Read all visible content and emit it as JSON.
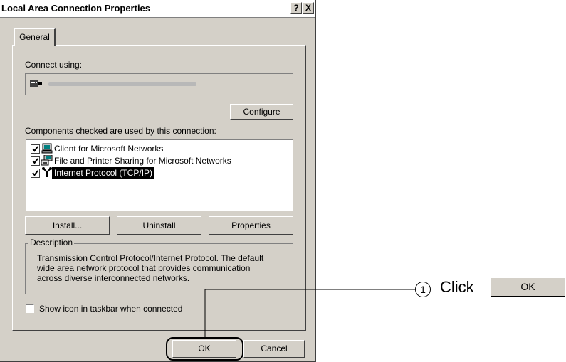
{
  "window": {
    "title": "Local Area Connection Properties",
    "help_label": "?",
    "close_label": "X"
  },
  "tabs": [
    {
      "label": "General"
    }
  ],
  "connect_using": {
    "label": "Connect using:",
    "adapter_icon": "network-card-icon"
  },
  "buttons": {
    "configure": "Configure",
    "install": "Install...",
    "uninstall": "Uninstall",
    "properties": "Properties",
    "ok": "OK",
    "cancel": "Cancel"
  },
  "components": {
    "label": "Components checked are used by this connection:",
    "items": [
      {
        "label": "Client for Microsoft Networks",
        "checked": true,
        "icon": "network-client-icon",
        "selected": false
      },
      {
        "label": "File and Printer Sharing for Microsoft Networks",
        "checked": true,
        "icon": "file-printer-sharing-icon",
        "selected": false
      },
      {
        "label": "Internet Protocol (TCP/IP)",
        "checked": true,
        "icon": "network-protocol-icon",
        "selected": true
      }
    ]
  },
  "description": {
    "title": "Description",
    "lines": [
      "Transmission Control Protocol/Internet Protocol. The default",
      "wide area network protocol that provides communication",
      "across diverse interconnected networks."
    ]
  },
  "show_icon": {
    "label": "Show icon in taskbar when connected",
    "checked": false
  },
  "callout": {
    "number": "1",
    "text": "Click",
    "button_label": "OK"
  },
  "colors": {
    "dialog_bg": "#d4d0c8",
    "selection_bg": "#000000",
    "selection_text": "#ffffff"
  }
}
